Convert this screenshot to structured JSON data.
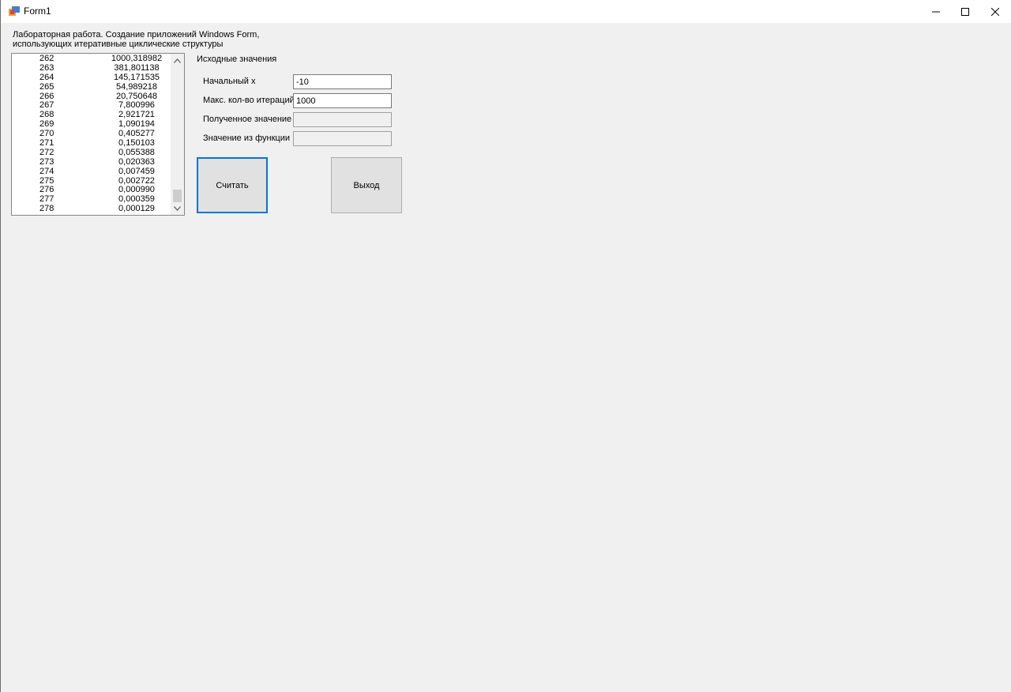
{
  "window": {
    "title": "Form1"
  },
  "header_text": [
    "Лабораторная работа. Создание приложений Windows Form,",
    "использующих итеративные циклические структуры"
  ],
  "list": {
    "rows": [
      {
        "index": "262",
        "value": "1000,318982"
      },
      {
        "index": "263",
        "value": "381,801138"
      },
      {
        "index": "264",
        "value": "145,171535"
      },
      {
        "index": "265",
        "value": "54,989218"
      },
      {
        "index": "266",
        "value": "20,750648"
      },
      {
        "index": "267",
        "value": "7,800996"
      },
      {
        "index": "268",
        "value": "2,921721"
      },
      {
        "index": "269",
        "value": "1,090194"
      },
      {
        "index": "270",
        "value": "0,405277"
      },
      {
        "index": "271",
        "value": "0,150103"
      },
      {
        "index": "272",
        "value": "0,055388"
      },
      {
        "index": "273",
        "value": "0,020363"
      },
      {
        "index": "274",
        "value": "0,007459"
      },
      {
        "index": "275",
        "value": "0,002722"
      },
      {
        "index": "276",
        "value": "0,000990"
      },
      {
        "index": "277",
        "value": "0,000359"
      },
      {
        "index": "278",
        "value": "0,000129"
      }
    ]
  },
  "group": {
    "label": "Исходные значения",
    "fields": {
      "start_x": {
        "label": "Начальный x",
        "value": "-10"
      },
      "max_iter": {
        "label": "Макс. кол-во итераций",
        "value": "1000"
      },
      "result": {
        "label": "Полученное значение",
        "value": ""
      },
      "func_value": {
        "label": "Значение из функции",
        "value": ""
      }
    }
  },
  "buttons": {
    "calculate": "Считать",
    "exit": "Выход"
  }
}
